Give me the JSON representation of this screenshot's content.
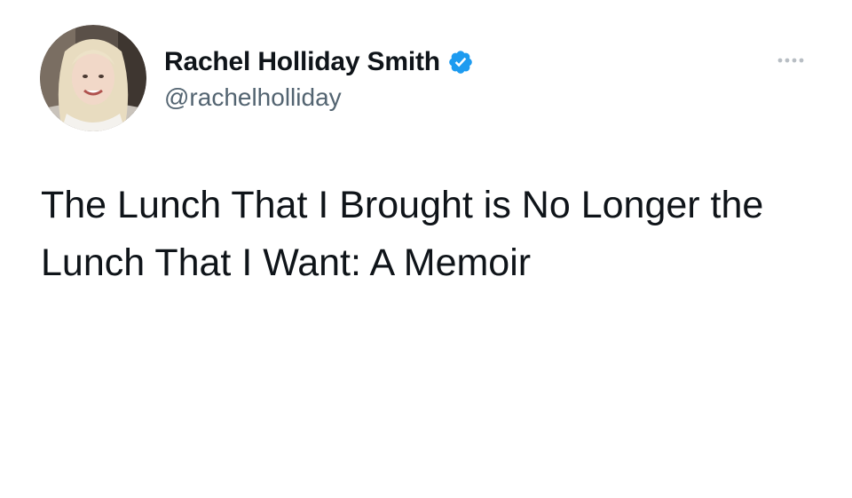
{
  "tweet": {
    "author": {
      "display_name": "Rachel Holliday Smith",
      "handle": "@rachelholliday",
      "verified": true,
      "verified_icon": "verified-badge-icon",
      "avatar_icon": "avatar"
    },
    "more_icon": "more-options-icon",
    "text": "The Lunch That I Brought is No Longer the Lunch That I Want: A Memoir"
  },
  "colors": {
    "background": "#ffffff",
    "text_primary": "#0f1419",
    "text_secondary": "#536471",
    "verified_blue": "#1d9bf0",
    "more_dots": "#b8bec4"
  }
}
